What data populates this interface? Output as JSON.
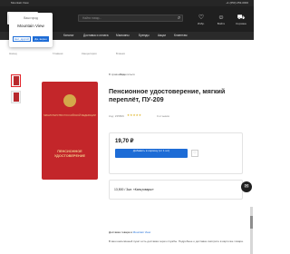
{
  "topbar": {
    "city": "Mountain View",
    "phone": "+1 (650) 253-0000"
  },
  "header": {
    "search_placeholder": "Найти товар...",
    "icons": [
      {
        "icon": "heart-icon",
        "label": "Избр."
      },
      {
        "icon": "user-icon",
        "label": "Войти"
      },
      {
        "icon": "cart-icon",
        "label": "Корзина"
      }
    ]
  },
  "nav": [
    "Каталог",
    "Доставка и оплата",
    "Магазины",
    "Бренды",
    "Акции",
    "Клиентам"
  ],
  "popup": {
    "question": "Ваш город",
    "city": "Mountain View",
    "no": "Нет, другой",
    "yes": "Да, верно"
  },
  "breadcrumbs": [
    "Назад",
    "Главная",
    "Канцелярия",
    "Бланки"
  ],
  "product": {
    "actions": [
      "В сравнение",
      "Поделиться"
    ],
    "title": "Пенсионное удостоверение, мягкий переплёт, ПУ-209",
    "code": "Код: 235809",
    "rating": "★★★★★",
    "reviews": "0 отзывов",
    "cover_top": "МИНИСТЕРСТВО РОССИЙСКОЙ ФЕДЕРАЦИИ",
    "cover_title": "ПЕНСИОННОЕ УДОСТОВЕРЕНИЕ",
    "price": "19,70 ₽",
    "cart_button": "Добавить в корзину (от 1 шт)",
    "stock": "13,500 / 3шт. «Канцтовары»",
    "delivery_label": "Доставка товара в",
    "delivery_city": "Mountain View",
    "description": "В ваш населённый пункт есть доставка через службы. Подробнее о доставке смотрите в карточке товара."
  },
  "colors": {
    "accent": "#1d6cd6",
    "brand": "#e3262c",
    "header": "#1f1f1f"
  }
}
